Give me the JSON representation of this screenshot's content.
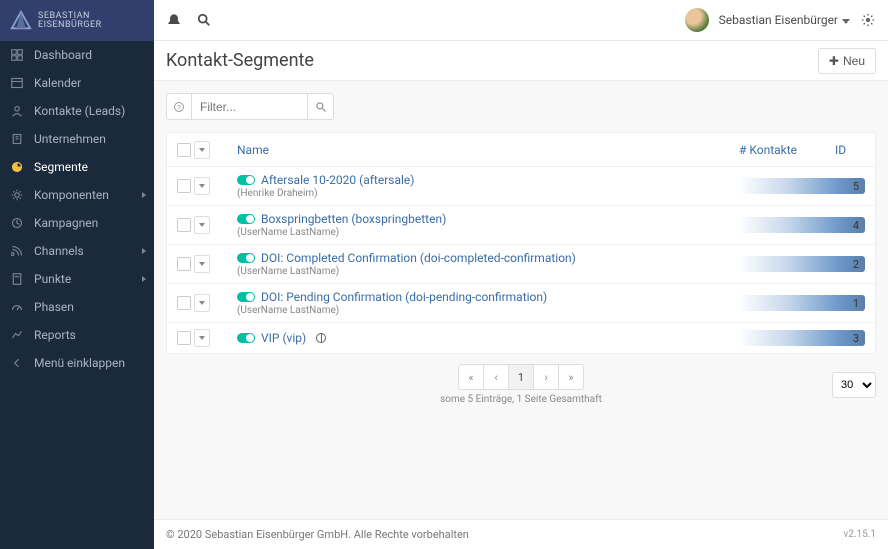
{
  "brand": {
    "line1": "SEBASTIAN",
    "line2": "EISENBÜRGER"
  },
  "topbar": {
    "user_name": "Sebastian Eisenbürger"
  },
  "sidebar": {
    "items": [
      {
        "label": "Dashboard",
        "icon": "dashboard-icon"
      },
      {
        "label": "Kalender",
        "icon": "calendar-icon"
      },
      {
        "label": "Kontakte (Leads)",
        "icon": "user-icon"
      },
      {
        "label": "Unternehmen",
        "icon": "building-icon"
      },
      {
        "label": "Segmente",
        "icon": "pie-icon",
        "active": true
      },
      {
        "label": "Komponenten",
        "icon": "gears-icon",
        "expandable": true
      },
      {
        "label": "Kampagnen",
        "icon": "clock-icon"
      },
      {
        "label": "Channels",
        "icon": "rss-icon",
        "expandable": true
      },
      {
        "label": "Punkte",
        "icon": "calc-icon",
        "expandable": true
      },
      {
        "label": "Phasen",
        "icon": "gauge-icon"
      },
      {
        "label": "Reports",
        "icon": "chart-icon"
      },
      {
        "label": "Menü einklappen",
        "icon": "collapse-icon"
      }
    ]
  },
  "page": {
    "title": "Kontakt-Segmente",
    "new_button": "Neu",
    "filter_placeholder": "Filter..."
  },
  "table": {
    "headers": {
      "name": "Name",
      "count": "# Kontakte",
      "id": "ID"
    },
    "rows": [
      {
        "title": "Aftersale 10-2020 (aftersale)",
        "subtitle": "(Henrike Draheim)",
        "count": "5",
        "id": "5",
        "public": false
      },
      {
        "title": "Boxspringbetten (boxspringbetten)",
        "subtitle": "(UserName LastName)",
        "count": "4",
        "id": "4",
        "public": false
      },
      {
        "title": "DOI: Completed Confirmation (doi-completed-confirmation)",
        "subtitle": "(UserName LastName)",
        "count": "2",
        "id": "2",
        "public": false
      },
      {
        "title": "DOI: Pending Confirmation (doi-pending-confirmation)",
        "subtitle": "(UserName LastName)",
        "count": "1",
        "id": "1",
        "public": false
      },
      {
        "title": "VIP (vip)",
        "subtitle": "",
        "count": "3",
        "id": "3",
        "public": true
      }
    ]
  },
  "pagination": {
    "first": "«",
    "prev": "‹",
    "current": "1",
    "next": "›",
    "last": "»",
    "info": "some 5 Einträge, 1 Seite Gesamthaft",
    "pagesize": "30"
  },
  "footer": {
    "copyright": "© 2020 Sebastian Eisenbürger GmbH. Alle Rechte vorbehalten",
    "version": "v2.15.1"
  }
}
